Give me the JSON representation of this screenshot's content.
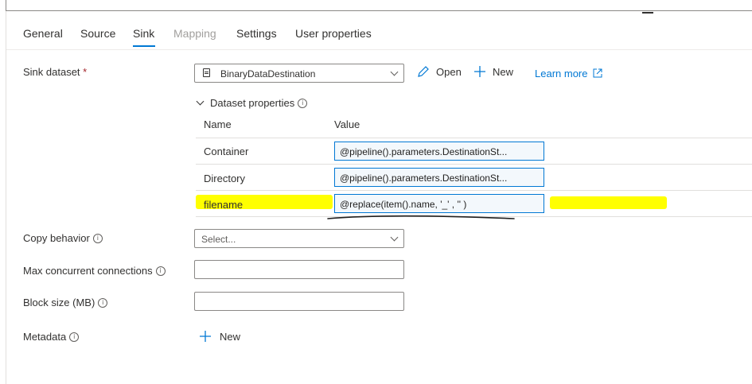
{
  "tabs": [
    {
      "label": "General",
      "state": "normal"
    },
    {
      "label": "Source",
      "state": "normal"
    },
    {
      "label": "Sink",
      "state": "active"
    },
    {
      "label": "Mapping",
      "state": "disabled"
    },
    {
      "label": "Settings",
      "state": "normal"
    },
    {
      "label": "User properties",
      "state": "normal"
    }
  ],
  "sink_dataset": {
    "label": "Sink dataset",
    "required_marker": "*",
    "selected": "BinaryDataDestination",
    "open_label": "Open",
    "new_label": "New",
    "learn_more_label": "Learn more"
  },
  "dataset_properties": {
    "header": "Dataset properties",
    "col_name": "Name",
    "col_value": "Value",
    "rows": [
      {
        "name": "Container",
        "value": "@pipeline().parameters.DestinationSt..."
      },
      {
        "name": "Directory",
        "value": "@pipeline().parameters.DestinationSt..."
      },
      {
        "name": "filename",
        "value": "@replace(item().name, '_' , '' )"
      }
    ]
  },
  "copy_behavior": {
    "label": "Copy behavior",
    "placeholder": "Select..."
  },
  "max_concurrent": {
    "label": "Max concurrent connections",
    "value": ""
  },
  "block_size": {
    "label": "Block size (MB)",
    "value": ""
  },
  "metadata": {
    "label": "Metadata",
    "new_label": "New"
  },
  "colors": {
    "accent": "#0078d4",
    "highlight": "#ffff00",
    "required": "#a4262c"
  }
}
